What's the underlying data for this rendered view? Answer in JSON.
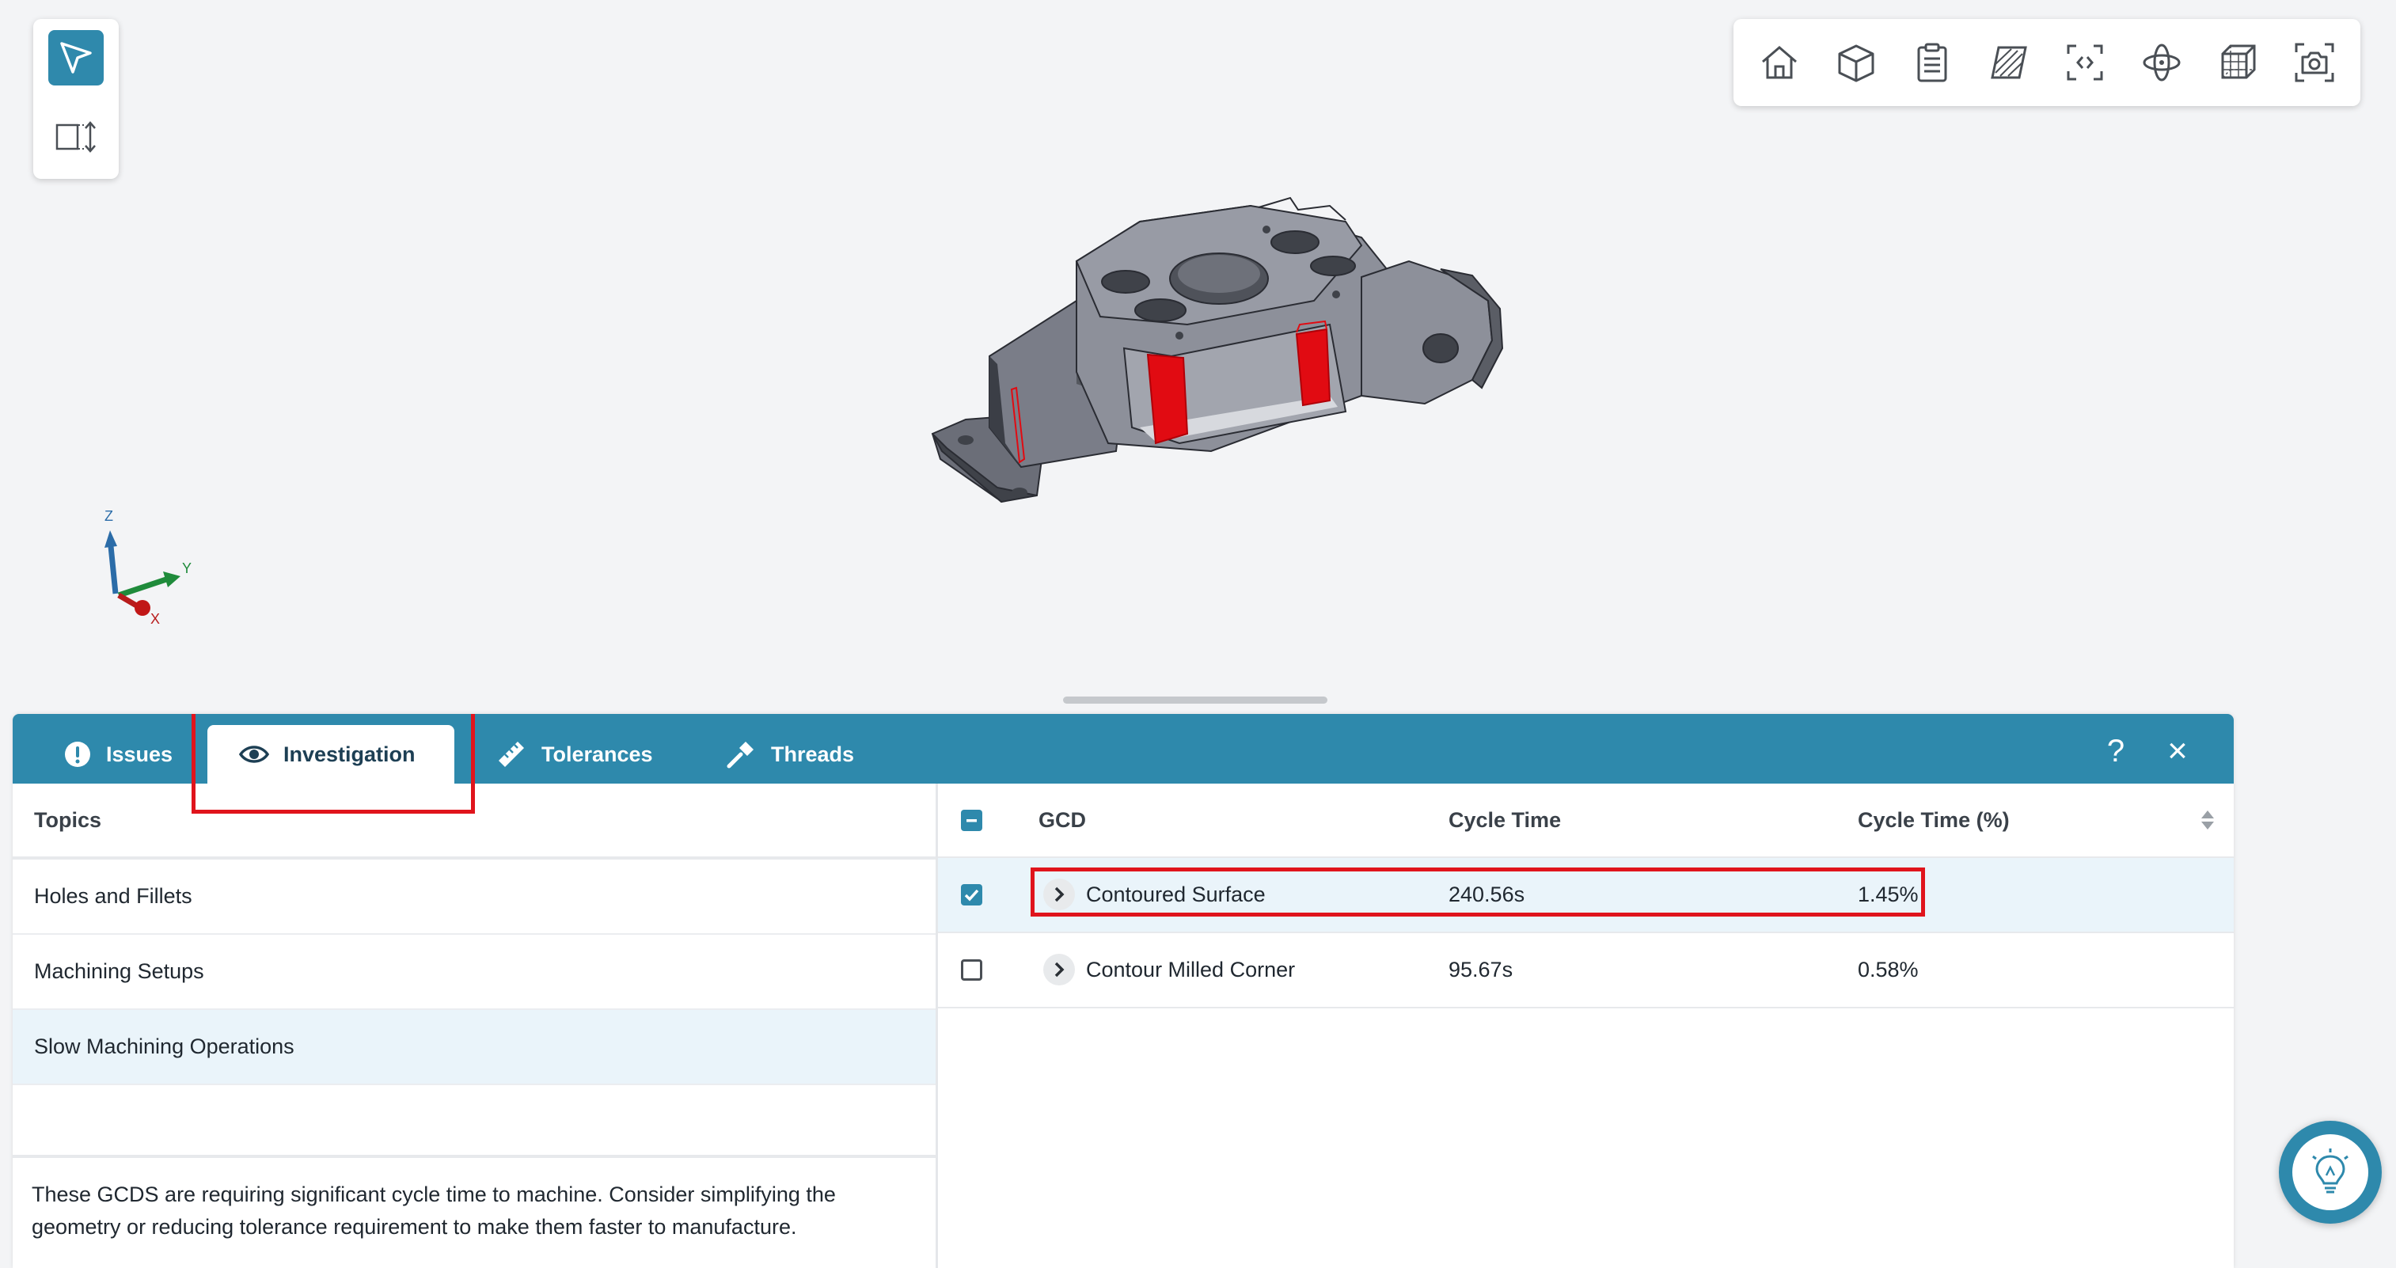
{
  "tabs": [
    {
      "label": "Issues",
      "icon": "alert-circle-icon"
    },
    {
      "label": "Investigation",
      "icon": "eye-icon"
    },
    {
      "label": "Tolerances",
      "icon": "ruler-icon"
    },
    {
      "label": "Threads",
      "icon": "screwdriver-icon"
    }
  ],
  "active_tab": "Investigation",
  "panel_actions": {
    "help": "?",
    "close": "×"
  },
  "axes": {
    "z": "Z",
    "y": "Y",
    "x": "X"
  },
  "topics": {
    "header": "Topics",
    "items": [
      "Holes and Fillets",
      "Machining Setups",
      "Slow Machining Operations"
    ],
    "selected": "Slow Machining Operations",
    "description": "These GCDS are requiring significant cycle time to machine. Consider simplifying the geometry or reducing tolerance requirement to make them faster to manufacture."
  },
  "grid": {
    "columns": [
      "GCD",
      "Cycle Time",
      "Cycle Time (%)"
    ],
    "rows": [
      {
        "gcd": "Contoured Surface",
        "cycle_time": "240.56s",
        "cycle_pct": "1.45%",
        "checked": true
      },
      {
        "gcd": "Contour Milled Corner",
        "cycle_time": "95.67s",
        "cycle_pct": "0.58%",
        "checked": false
      }
    ]
  },
  "toolbar_icons": [
    "home-icon",
    "cube-icon",
    "clipboard-list-icon",
    "section-hatch-icon",
    "fit-view-icon",
    "orbit-icon",
    "wireframe-cube-icon",
    "camera-icon"
  ],
  "colors": {
    "accent": "#2e89ac",
    "highlight": "#e0141c"
  }
}
